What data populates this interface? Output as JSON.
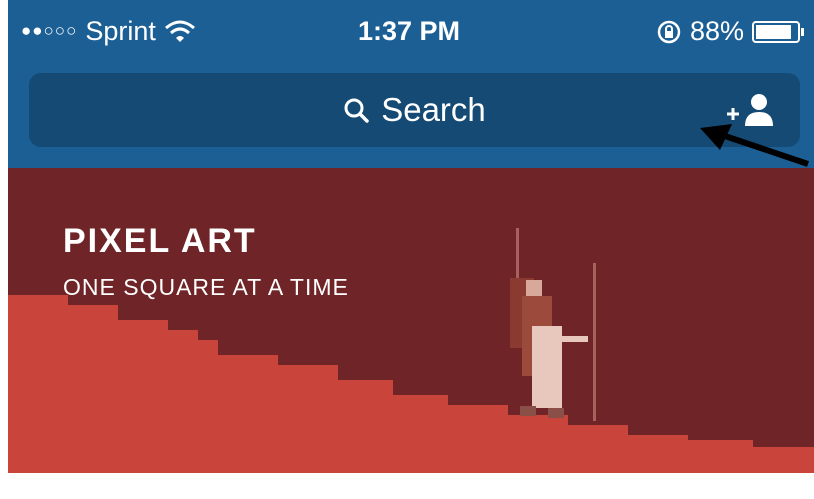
{
  "status_bar": {
    "signal": "●●○○○",
    "carrier": "Sprint",
    "time": "1:37 PM",
    "battery_percent": "88%",
    "battery_level": 0.88,
    "icons": [
      "wifi-icon",
      "rotation-lock-icon",
      "battery-icon"
    ]
  },
  "search": {
    "placeholder": "Search",
    "icons": [
      "search-icon",
      "add-user-icon"
    ]
  },
  "banner": {
    "title": "PIXEL ART",
    "subtitle": "ONE SQUARE AT A TIME"
  },
  "colors": {
    "header": "#1c5f95",
    "search_field": "#144a73",
    "banner_bg": "#6f2527",
    "hills": "#c9443a"
  }
}
